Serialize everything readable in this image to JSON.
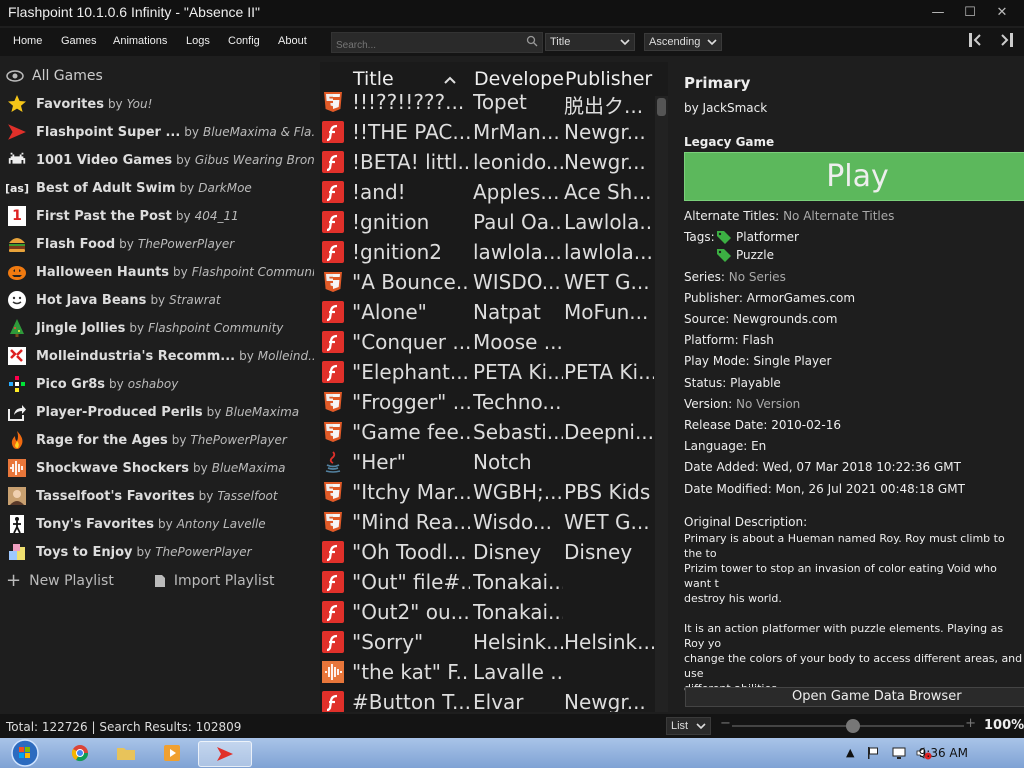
{
  "window": {
    "title": "Flashpoint 10.1.0.6 Infinity - \"Absence II\""
  },
  "menu": [
    "Home",
    "Games",
    "Animations",
    "Logs",
    "Config",
    "About"
  ],
  "search": {
    "placeholder": "Search..."
  },
  "sort_field": "Title",
  "sort_order": "Ascending",
  "sidebar": {
    "all_games": "All Games",
    "playlists": [
      {
        "name": "Favorites",
        "by": "by",
        "author": "You!",
        "icon": "star-icon"
      },
      {
        "name": "Flashpoint Super ...",
        "by": "by",
        "author": "BlueMaxima & Fla...",
        "icon": "flashpoint-icon"
      },
      {
        "name": "1001 Video Games",
        "by": "by",
        "author": "Gibus Wearing Brony",
        "icon": "invader-icon"
      },
      {
        "name": "Best of Adult Swim",
        "by": "by",
        "author": "DarkMoe",
        "icon": "adultswim-icon"
      },
      {
        "name": "First Past the Post",
        "by": "by",
        "author": "404_11",
        "icon": "number-one-icon"
      },
      {
        "name": "Flash Food",
        "by": "by",
        "author": "ThePowerPlayer",
        "icon": "burger-icon"
      },
      {
        "name": "Halloween Haunts",
        "by": "by",
        "author": "Flashpoint Community",
        "icon": "pumpkin-icon"
      },
      {
        "name": "Hot Java Beans",
        "by": "by",
        "author": "Strawrat",
        "icon": "java-icon"
      },
      {
        "name": "Jingle Jollies",
        "by": "by",
        "author": "Flashpoint Community",
        "icon": "tree-icon"
      },
      {
        "name": "Molleindustria's Recomm...",
        "by": "by",
        "author": "Molleind...",
        "icon": "molleindustria-icon"
      },
      {
        "name": "Pico Gr8s",
        "by": "by",
        "author": "oshaboy",
        "icon": "pico-icon"
      },
      {
        "name": "Player-Produced Perils",
        "by": "by",
        "author": "BlueMaxima",
        "icon": "share-icon"
      },
      {
        "name": "Rage for the Ages",
        "by": "by",
        "author": "ThePowerPlayer",
        "icon": "flame-icon"
      },
      {
        "name": "Shockwave Shockers",
        "by": "by",
        "author": "BlueMaxima",
        "icon": "shockwave-icon"
      },
      {
        "name": "Tasselfoot's Favorites",
        "by": "by",
        "author": "Tasselfoot",
        "icon": "portrait-icon"
      },
      {
        "name": "Tony's Favorites",
        "by": "by",
        "author": "Antony Lavelle",
        "icon": "figure-icon"
      },
      {
        "name": "Toys to Enjoy",
        "by": "by",
        "author": "ThePowerPlayer",
        "icon": "blocks-icon"
      }
    ],
    "new_playlist": "New Playlist",
    "import_playlist": "Import Playlist"
  },
  "game_list": {
    "columns": [
      "Title",
      "Develope",
      "Publisher"
    ],
    "rows": [
      {
        "icon": "html5",
        "title": "!!!??!!???...",
        "developer": "Topet",
        "publisher": "脱出ク..."
      },
      {
        "icon": "flash",
        "title": "!!THE PAC...",
        "developer": "MrMan...",
        "publisher": "Newgr..."
      },
      {
        "icon": "flash",
        "title": "!BETA! littl...",
        "developer": "leonido...",
        "publisher": "Newgr..."
      },
      {
        "icon": "flash",
        "title": "!and!",
        "developer": "Apples...",
        "publisher": "Ace Sh..."
      },
      {
        "icon": "flash",
        "title": "!gnition",
        "developer": "Paul Oa...",
        "publisher": "Lawlola..."
      },
      {
        "icon": "flash",
        "title": "!gnition2",
        "developer": "lawlola...",
        "publisher": "lawlola..."
      },
      {
        "icon": "html5",
        "title": "\"A Bounce...",
        "developer": "WISDO...",
        "publisher": "WET G..."
      },
      {
        "icon": "flash",
        "title": "\"Alone\"",
        "developer": "Natpat",
        "publisher": "MoFun..."
      },
      {
        "icon": "flash",
        "title": "\"Conquer ...",
        "developer": "Moose ...",
        "publisher": ""
      },
      {
        "icon": "flash",
        "title": "\"Elephant...",
        "developer": "PETA Ki...",
        "publisher": "PETA Ki..."
      },
      {
        "icon": "html5",
        "title": "\"Frogger\" ...",
        "developer": "Techno...",
        "publisher": ""
      },
      {
        "icon": "html5",
        "title": "\"Game fee...",
        "developer": "Sebasti...",
        "publisher": "Deepni..."
      },
      {
        "icon": "java",
        "title": "\"Her\"",
        "developer": "Notch",
        "publisher": ""
      },
      {
        "icon": "html5",
        "title": "\"Itchy Mar...",
        "developer": "WGBH;...",
        "publisher": "PBS Kids"
      },
      {
        "icon": "html5",
        "title": "\"Mind Rea...",
        "developer": "Wisdo...",
        "publisher": "WET G..."
      },
      {
        "icon": "flash",
        "title": "\"Oh Toodl...",
        "developer": "Disney",
        "publisher": "Disney"
      },
      {
        "icon": "flash",
        "title": "\"Out\" file#...",
        "developer": "Tonakai...",
        "publisher": ""
      },
      {
        "icon": "flash",
        "title": "\"Out2\" ou...",
        "developer": "Tonakai...",
        "publisher": ""
      },
      {
        "icon": "flash",
        "title": "\"Sorry\"",
        "developer": "Helsink...",
        "publisher": "Helsink..."
      },
      {
        "icon": "shockwave",
        "title": "\"the kat\" F...",
        "developer": "Lavalle ...",
        "publisher": ""
      },
      {
        "icon": "flash",
        "title": "#Button T...",
        "developer": "Elvar",
        "publisher": "Newgr..."
      }
    ]
  },
  "details": {
    "title": "Primary",
    "by_line": "by JackSmack",
    "legacy": "Legacy Game",
    "play": "Play",
    "alt_titles_label": "Alternate Titles:",
    "alt_titles_value": "No Alternate Titles",
    "tags_label": "Tags:",
    "tags": [
      "Platformer",
      "Puzzle"
    ],
    "series_label": "Series:",
    "series_value": "No Series",
    "publisher": "Publisher: ArmorGames.com",
    "source": "Source: Newgrounds.com",
    "platform": "Platform: Flash",
    "play_mode": "Play Mode: Single Player",
    "status": "Status: Playable",
    "version_label": "Version:",
    "version_value": "No Version",
    "release_date": "Release Date: 2010-02-16",
    "language": "Language: En",
    "date_added": "Date Added:  Wed, 07 Mar 2018 10:22:36 GMT",
    "date_modified": "Date Modified:  Mon, 26 Jul 2021 00:48:18 GMT",
    "desc_label": "Original Description:",
    "desc_lines": [
      "Primary is about a Hueman named Roy. Roy must climb to the to",
      "Prizim tower to stop an invasion of color eating Void who want t",
      "destroy his world.",
      "",
      "It is an action platformer with puzzle elements. Playing as Roy yo",
      "change the colors of your body to access different areas, and use",
      "different abilities."
    ],
    "open_data": "Open Game Data Browser"
  },
  "status": {
    "text": "Total: 122726  |  Search Results: 102809",
    "view": "List",
    "zoom": "100%",
    "zoom_slider_level": 0.52
  },
  "taskbar": {
    "clock": "9:36 AM"
  },
  "colors": {
    "play_green": "#5cb85c",
    "flash_red": "#e0302a",
    "html5_orange": "#e05a27",
    "tag_green": "#3cb043"
  }
}
